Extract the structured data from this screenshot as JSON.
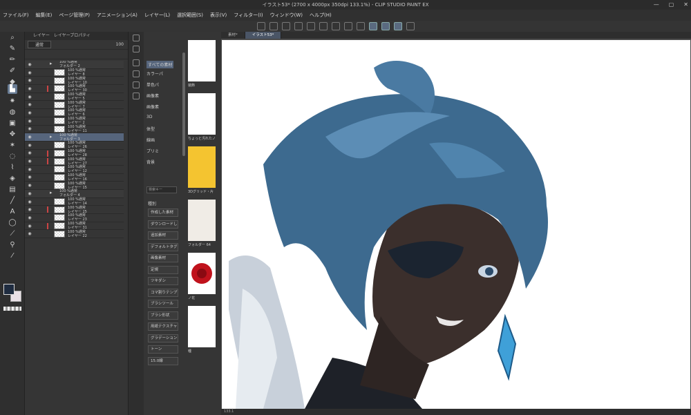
{
  "window": {
    "title": "イラスト53* (2700 x 4000px 350dpi 133.1%) - CLIP STUDIO PAINT EX",
    "controls": [
      "—",
      "▢",
      "✕"
    ]
  },
  "menu": [
    "ファイル(F)",
    "編集(E)",
    "ページ管理(P)",
    "アニメーション(A)",
    "レイヤー(L)",
    "選択範囲(S)",
    "表示(V)",
    "フィルター(I)",
    "ウィンドウ(W)",
    "ヘルプ(H)"
  ],
  "layer_panel": {
    "tabs": [
      "レイヤー",
      "レイヤープロパティ"
    ],
    "blend_mode": "通常",
    "opacity": "100",
    "layers": [
      {
        "mode": "100 %通常",
        "name": "フォルダー 2",
        "folder": true
      },
      {
        "mode": "100 %通常",
        "name": "レイヤー 8"
      },
      {
        "mode": "100 %通常",
        "name": "レイヤー 10"
      },
      {
        "mode": "100 %通常",
        "name": "レイヤー 30",
        "mark": true
      },
      {
        "mode": "100 %通常",
        "name": "レイヤー 5"
      },
      {
        "mode": "100 %通常",
        "name": "レイヤー 7"
      },
      {
        "mode": "100 %通常",
        "name": "レイヤー 6"
      },
      {
        "mode": "100 %通常",
        "name": "レイヤー 2"
      },
      {
        "mode": "100 %通常",
        "name": "レイヤー 11"
      },
      {
        "mode": "100 %通常",
        "name": "フォルダー 3",
        "folder": true,
        "selected": true
      },
      {
        "mode": "100 %通常",
        "name": "レイヤー 26"
      },
      {
        "mode": "100 %通常",
        "name": "レイヤー 28",
        "mark": true
      },
      {
        "mode": "100 %通常",
        "name": "レイヤー 27",
        "mark": true
      },
      {
        "mode": "100 %通常",
        "name": "レイヤー 12"
      },
      {
        "mode": "100 %通常",
        "name": "レイヤー 16"
      },
      {
        "mode": "100 %通常",
        "name": "レイヤー 15"
      },
      {
        "mode": "100 %通常",
        "name": "フォルダー 4",
        "folder": true
      },
      {
        "mode": "100 %通常",
        "name": "レイヤー 14"
      },
      {
        "mode": "100 %通常",
        "name": "レイヤー 25",
        "mark": true
      },
      {
        "mode": "100 %通常",
        "name": "レイヤー 23"
      },
      {
        "mode": "100 %通常",
        "name": "レイヤー 31",
        "mark": true
      },
      {
        "mode": "100 %通常",
        "name": "レイヤー 22"
      }
    ]
  },
  "material_panel": {
    "tree": [
      {
        "label": "すべての素材",
        "selected": true
      },
      {
        "label": "カラーパ"
      },
      {
        "label": "単色パ"
      },
      {
        "label": "画像素"
      },
      {
        "label": "画像素"
      },
      {
        "label": "3D"
      },
      {
        "label": "体型"
      },
      {
        "label": "線画"
      },
      {
        "label": "プリミ"
      },
      {
        "label": "背景"
      }
    ],
    "search_placeholder": "検索キー",
    "tags_title": "種別",
    "tags": [
      "作成した素材",
      "ダウンロードした",
      "追加素材",
      "デフォルトタグ",
      "画像素材",
      "定規",
      "ツキダシ",
      "コマ割りテンプ",
      "ブラシツール",
      "ブラシ形状",
      "用紙テクスチャ",
      "グラデーション",
      "トーン",
      "15.0線"
    ],
    "thumbs": [
      {
        "label": "装飾"
      },
      {
        "label": "ちょっと汚れたノ"
      },
      {
        "label": "3Dグリッド・片"
      },
      {
        "label": "フォルダー 64"
      },
      {
        "label": "ノ花"
      },
      {
        "label": "種"
      }
    ]
  },
  "canvas": {
    "tabs": [
      "素材*",
      "イラスト53*"
    ],
    "active_tab": 1,
    "status": "133.1"
  },
  "colors": {
    "main": "#1f2c40",
    "sub": "#e9e0e6",
    "accent": "#56657c"
  }
}
